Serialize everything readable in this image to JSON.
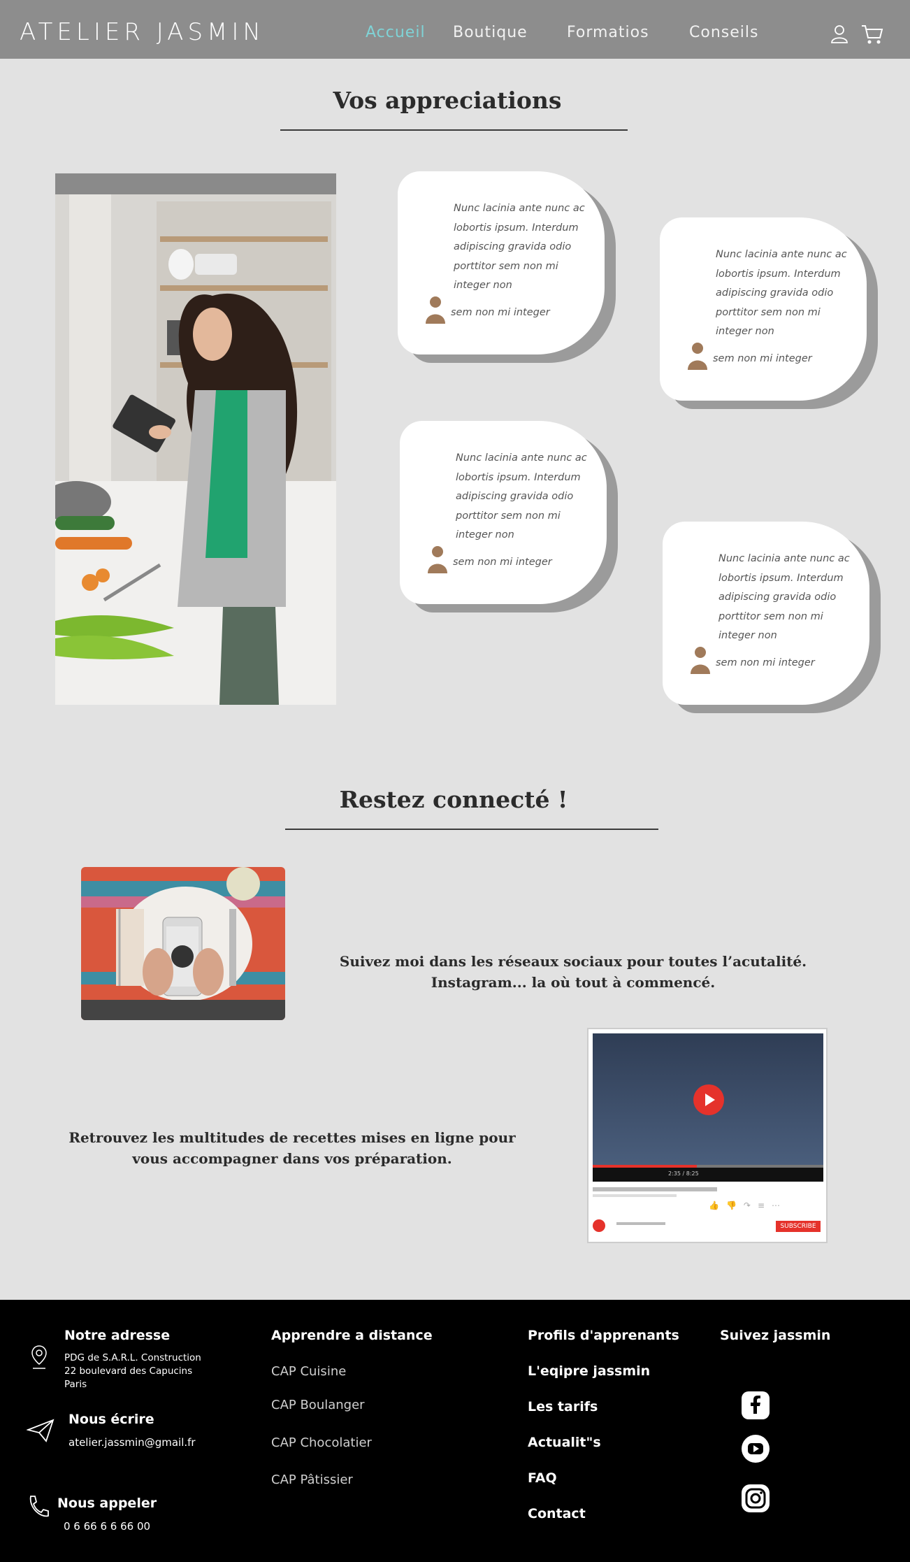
{
  "header": {
    "logo": "ATELIER JASMIN",
    "nav": [
      "Accueil",
      "Boutique",
      "Formatios",
      "Conseils"
    ],
    "active_nav": "Accueil",
    "accent_color": "#7fd3d6",
    "icons": [
      "user-icon",
      "cart-icon"
    ]
  },
  "reviews": {
    "title": "Vos appreciations",
    "items": [
      {
        "text": "Nunc lacinia ante nunc ac lobortis ipsum. Interdum adipiscing gravida odio porttitor sem non mi integer non",
        "name": "sem non mi integer"
      },
      {
        "text": "Nunc lacinia ante nunc ac lobortis ipsum. Interdum adipiscing gravida odio porttitor sem non mi integer non",
        "name": "sem non mi integer"
      },
      {
        "text": "Nunc lacinia ante nunc ac lobortis ipsum. Interdum adipiscing gravida odio porttitor sem non mi integer non",
        "name": "sem non mi integer"
      },
      {
        "text": "Nunc lacinia ante nunc ac lobortis ipsum. Interdum adipiscing gravida odio porttitor sem non mi integer non",
        "name": "sem non mi integer"
      }
    ]
  },
  "connect": {
    "title": "Restez connecté !",
    "instagram_text": "Suivez moi dans les réseaux sociaux pour toutes l’acutalité. Instagram... la où tout à commencé.",
    "youtube_text": "Retrouvez les multitudes de recettes mises en ligne pour vous accompagner dans vos préparation.",
    "video_time": "2:35 / 8:25",
    "subscribe_label": "SUBSCRIBE"
  },
  "footer": {
    "address_title": "Notre adresse",
    "address_lines": [
      "PDG de S.A.R.L. Construction",
      "22 boulevard des Capucins",
      "Paris"
    ],
    "write_title": "Nous écrire",
    "email": "atelier.jassmin@gmail.fr",
    "call_title": "Nous appeler",
    "phone": "0 6 66 6 6 66 00",
    "distance_title": "Apprendre a distance",
    "courses": [
      "CAP Cuisine",
      "CAP Boulanger",
      "CAP Chocolatier",
      "CAP Pâtissier"
    ],
    "links": [
      "Profils d'apprenants",
      "L'eqipre jassmin",
      "Les tarifs",
      "Actualit\"s",
      "FAQ",
      "Contact"
    ],
    "follow_title": "Suivez jassmin",
    "social_icons": [
      "facebook-icon",
      "youtube-icon",
      "instagram-icon"
    ]
  }
}
